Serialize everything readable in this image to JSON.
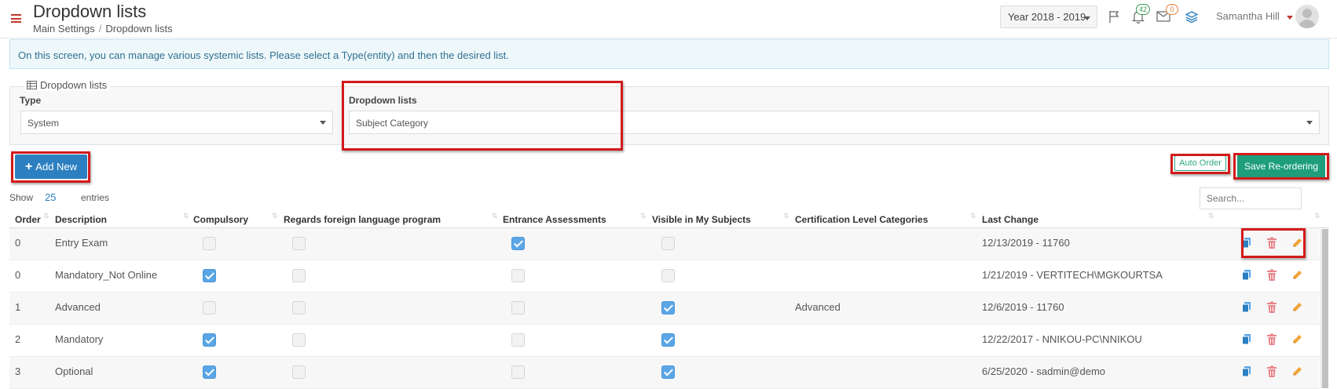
{
  "header": {
    "title": "Dropdown lists",
    "breadcrumb": [
      "Main Settings",
      "Dropdown lists"
    ],
    "breadcrumb_separator": "/",
    "year_select": "Year 2018 - 2019",
    "notifications_count": "42",
    "messages_count": "0",
    "user_name": "Samantha Hill"
  },
  "info": {
    "text": "On this screen, you can manage various systemic lists. Please select a Type(entity) and then the desired list."
  },
  "filters": {
    "legend": "Dropdown lists",
    "type_label": "Type",
    "type_value": "System",
    "list_label": "Dropdown lists",
    "list_value": "Subject Category"
  },
  "toolbar": {
    "add_label": "Add New",
    "auto_order_label": "Auto Order",
    "save_label": "Save Re-ordering"
  },
  "table_controls": {
    "show_label": "Show",
    "show_count": "25",
    "entries_label": "entries",
    "search_placeholder": "Search..."
  },
  "table": {
    "columns": [
      "Order",
      "Description",
      "Compulsory",
      "Regards foreign language program",
      "Entrance Assessments",
      "Visible in My Subjects",
      "Certification Level Categories",
      "Last Change"
    ],
    "rows": [
      {
        "order": "0",
        "description": "Entry Exam",
        "compulsory": false,
        "foreign": false,
        "entrance": true,
        "visible": false,
        "cert": "",
        "last_change": "12/13/2019 - 11760"
      },
      {
        "order": "0",
        "description": "Mandatory_Not Online",
        "compulsory": true,
        "foreign": false,
        "entrance": false,
        "visible": false,
        "cert": "",
        "last_change": "1/21/2019 - VERTITECH\\MGKOURTSA"
      },
      {
        "order": "1",
        "description": "Advanced",
        "compulsory": false,
        "foreign": false,
        "entrance": false,
        "visible": true,
        "cert": "Advanced",
        "last_change": "12/6/2019 - 11760"
      },
      {
        "order": "2",
        "description": "Mandatory",
        "compulsory": true,
        "foreign": false,
        "entrance": false,
        "visible": true,
        "cert": "",
        "last_change": "12/22/2017 - NNIKOU-PC\\NNIKOU"
      },
      {
        "order": "3",
        "description": "Optional",
        "compulsory": true,
        "foreign": false,
        "entrance": false,
        "visible": true,
        "cert": "",
        "last_change": "6/25/2020 - sadmin@demo"
      }
    ],
    "row_actions": [
      "copy-icon",
      "delete-icon",
      "edit-icon"
    ]
  },
  "colors": {
    "primary": "#2c7fc0",
    "success": "#1e9e7a",
    "highlight": "#d21a1a",
    "checkbox_on": "#5aa6e6",
    "menu_accent": "#c0392b"
  }
}
